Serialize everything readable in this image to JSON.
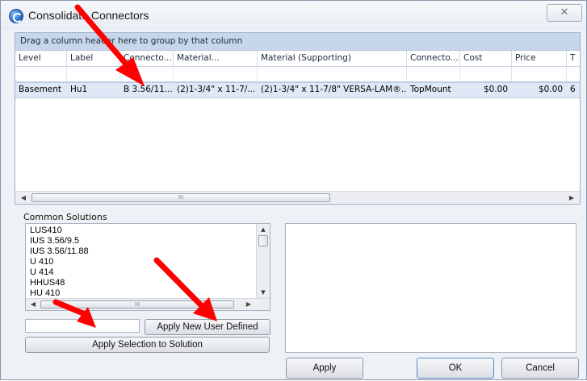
{
  "window": {
    "title": "Consolidate Connectors",
    "close_glyph": "✕"
  },
  "grid": {
    "group_hint": "Drag a column header here to group by that column",
    "columns": [
      "Level",
      "Label",
      "Connecto...",
      "Material...",
      "Material (Supporting)",
      "Connecto...",
      "Cost",
      "Price",
      "T"
    ],
    "rows": [
      [
        "Basement",
        "Hu1",
        "B 3.56/11...",
        "(2)1-3/4\" x 11-7/...",
        "(2)1-3/4\" x 11-7/8\" VERSA-LAM®...",
        "TopMount",
        "$0.00",
        "$0.00",
        "6"
      ]
    ],
    "scroll_thumb_mark": "III"
  },
  "solutions": {
    "label": "Common Solutions",
    "items": [
      "LUS410",
      "IUS 3.56/9.5",
      "IUS 3.56/11.88",
      "U 410",
      "U 414",
      "HHUS48",
      "HU 410"
    ],
    "scroll_thumb_mark": "III"
  },
  "inputs": {
    "user_defined_value": ""
  },
  "buttons": {
    "apply_new_user_defined": "Apply New User Defined",
    "apply_selection": "Apply Selection to Solution",
    "apply": "Apply",
    "ok": "OK",
    "cancel": "Cancel"
  },
  "colors": {
    "annotation_arrow": "#ff0000",
    "selected_row": "#dfe8f6",
    "group_panel": "#c7d6ea"
  }
}
